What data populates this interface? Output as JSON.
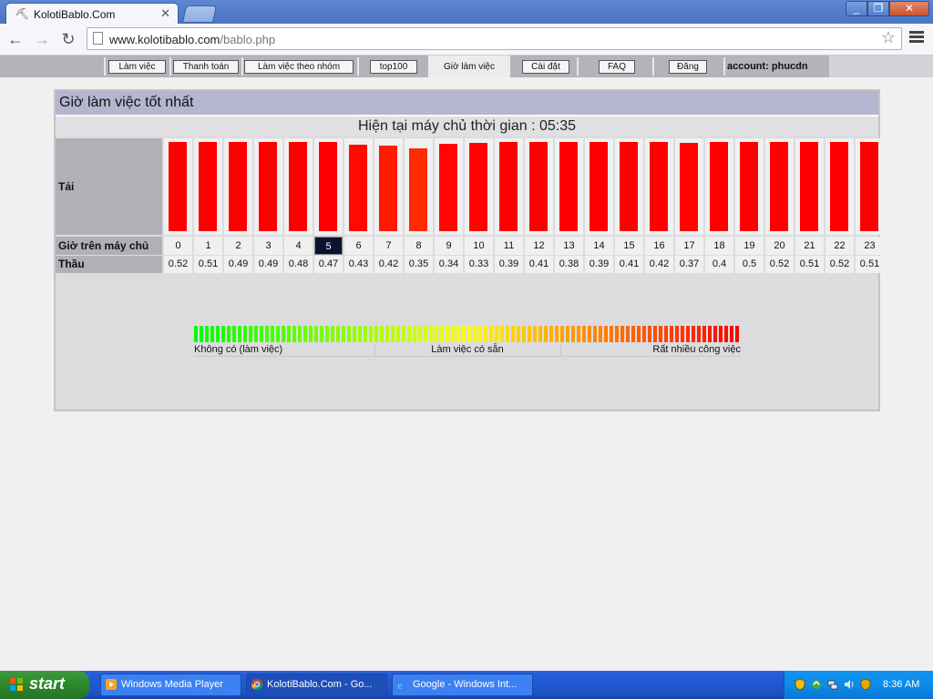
{
  "browser": {
    "tab_title": "KolotiBablo.Com",
    "url_host": "www.kolotibablo.com",
    "url_path": "/bablo.php",
    "window_controls": [
      "_",
      "❐",
      "✕"
    ]
  },
  "sitenav": {
    "items": [
      {
        "label": "Làm việc"
      },
      {
        "label": "Thanh toán"
      },
      {
        "label": "Làm việc theo nhóm"
      },
      {
        "label": "top100"
      },
      {
        "label": "Giờ làm việc",
        "active": true
      },
      {
        "label": "Cài đặt"
      },
      {
        "label": "FAQ"
      },
      {
        "label": "Đăng"
      }
    ],
    "account_text": "account: phucdn"
  },
  "panel": {
    "title": "Giờ làm việc tốt nhất",
    "server_time_text": "Hiện tại máy chủ thời gian : 05:35",
    "row_load_label": "Tải",
    "row_hour_label": "Giờ trên máy chủ",
    "row_rate_label": "Thầu",
    "current_hour": 5
  },
  "chart_data": {
    "type": "bar",
    "categories": [
      "0",
      "1",
      "2",
      "3",
      "4",
      "5",
      "6",
      "7",
      "8",
      "9",
      "10",
      "11",
      "12",
      "13",
      "14",
      "15",
      "16",
      "17",
      "18",
      "19",
      "20",
      "21",
      "22",
      "23"
    ],
    "values": [
      1.0,
      1.0,
      1.0,
      1.0,
      1.0,
      1.0,
      0.97,
      0.96,
      0.93,
      0.98,
      0.99,
      1.0,
      1.0,
      1.0,
      1.0,
      1.0,
      1.0,
      0.99,
      1.0,
      1.0,
      1.0,
      1.0,
      1.0,
      1.0
    ],
    "bar_colors": [
      "#ff0000",
      "#ff0000",
      "#ff0000",
      "#ff0000",
      "#ff0000",
      "#ff0000",
      "#ff0a00",
      "#ff1a00",
      "#ff2a00",
      "#ff0700",
      "#ff0500",
      "#ff0000",
      "#ff0000",
      "#ff0000",
      "#ff0000",
      "#ff0000",
      "#ff0000",
      "#ff0500",
      "#ff0000",
      "#ff0000",
      "#ff0000",
      "#ff0000",
      "#ff0000",
      "#ff0000"
    ],
    "rates": [
      "0.52",
      "0.51",
      "0.49",
      "0.49",
      "0.48",
      "0.47",
      "0.43",
      "0.42",
      "0.35",
      "0.34",
      "0.33",
      "0.39",
      "0.41",
      "0.38",
      "0.39",
      "0.41",
      "0.42",
      "0.37",
      "0.4",
      "0.5",
      "0.52",
      "0.51",
      "0.52",
      "0.51"
    ]
  },
  "legend": {
    "labels": [
      "Không có (làm việc)",
      "Làm việc có sẵn",
      "Rất nhiều công việc"
    ],
    "gradient_from": "#00ff00",
    "gradient_mid": "#ffff00",
    "gradient_to": "#ff0000"
  },
  "taskbar": {
    "start_label": "start",
    "buttons": [
      {
        "label": "Windows Media Player"
      },
      {
        "label": "KolotiBablo.Com - Go...",
        "active": true
      },
      {
        "label": "Google - Windows Int..."
      }
    ],
    "clock": "8:36 AM"
  }
}
